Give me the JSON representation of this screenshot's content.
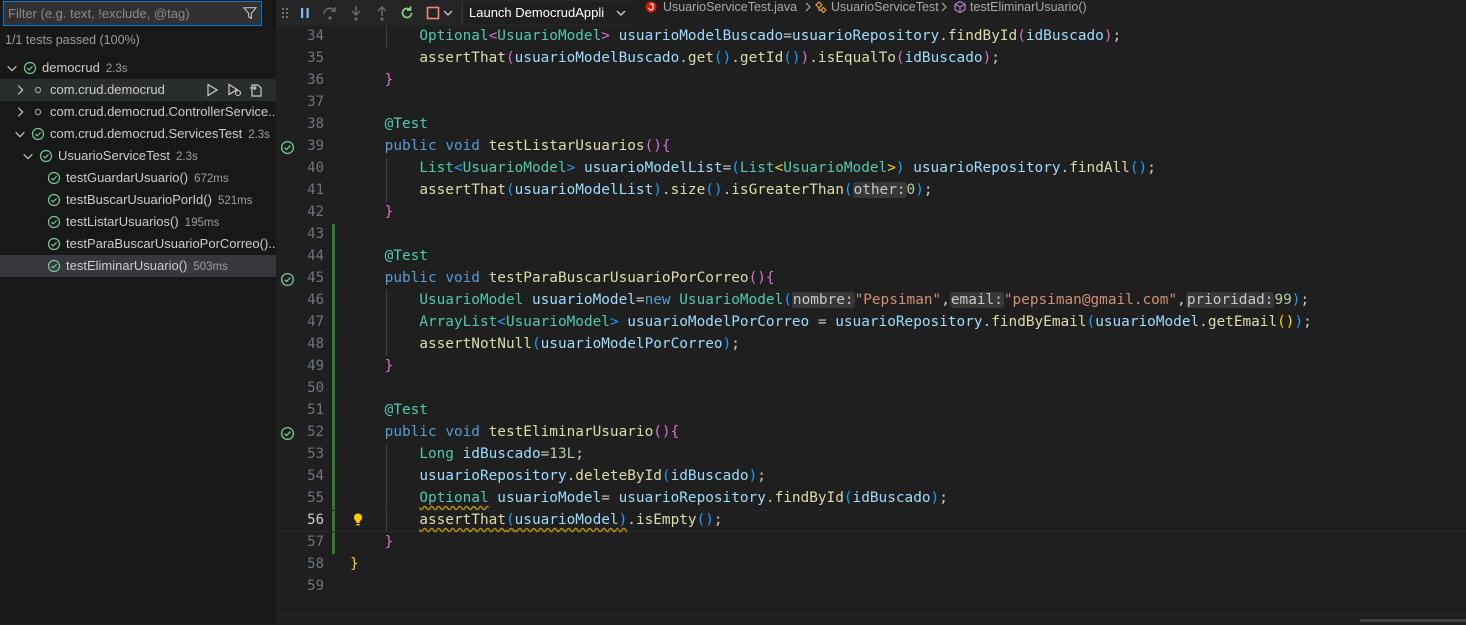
{
  "sidebar": {
    "filter_placeholder": "Filter (e.g. text, !exclude, @tag)",
    "summary": "1/1 tests passed (100%)",
    "tree": [
      {
        "label": "democrud",
        "duration": "2.3s"
      },
      {
        "label": "com.crud.democrud",
        "duration": ""
      },
      {
        "label": "com.crud.democrud.ControllerService...",
        "duration": ""
      },
      {
        "label": "com.crud.democrud.ServicesTest",
        "duration": "2.3s"
      },
      {
        "label": "UsuarioServiceTest",
        "duration": "2.3s"
      },
      {
        "label": "testGuardarUsuario()",
        "duration": "672ms"
      },
      {
        "label": "testBuscarUsuarioPorId()",
        "duration": "521ms"
      },
      {
        "label": "testListarUsuarios()",
        "duration": "195ms"
      },
      {
        "label": "testParaBuscarUsuarioPorCorreo()...",
        "duration": ""
      },
      {
        "label": "testEliminarUsuario()",
        "duration": "503ms"
      }
    ]
  },
  "debug": {
    "launch_config": "Launch DemocrudAppli"
  },
  "breadcrumbs": [
    "UsuarioServiceTest.java",
    "UsuarioServiceTest",
    "testEliminarUsuario()"
  ],
  "editor": {
    "line_numbers": [
      "34",
      "35",
      "36",
      "37",
      "38",
      "39",
      "40",
      "41",
      "42",
      "43",
      "44",
      "45",
      "46",
      "47",
      "48",
      "49",
      "50",
      "51",
      "52",
      "53",
      "54",
      "55",
      "56",
      "57",
      "58",
      "59"
    ],
    "hints": {
      "other": "other:",
      "nombre": "nombre:",
      "email": "email:",
      "prioridad": "prioridad:"
    }
  },
  "colors": {
    "accent": "#0078d4",
    "pass": "#73c991",
    "bulb": "#ffcc00"
  }
}
